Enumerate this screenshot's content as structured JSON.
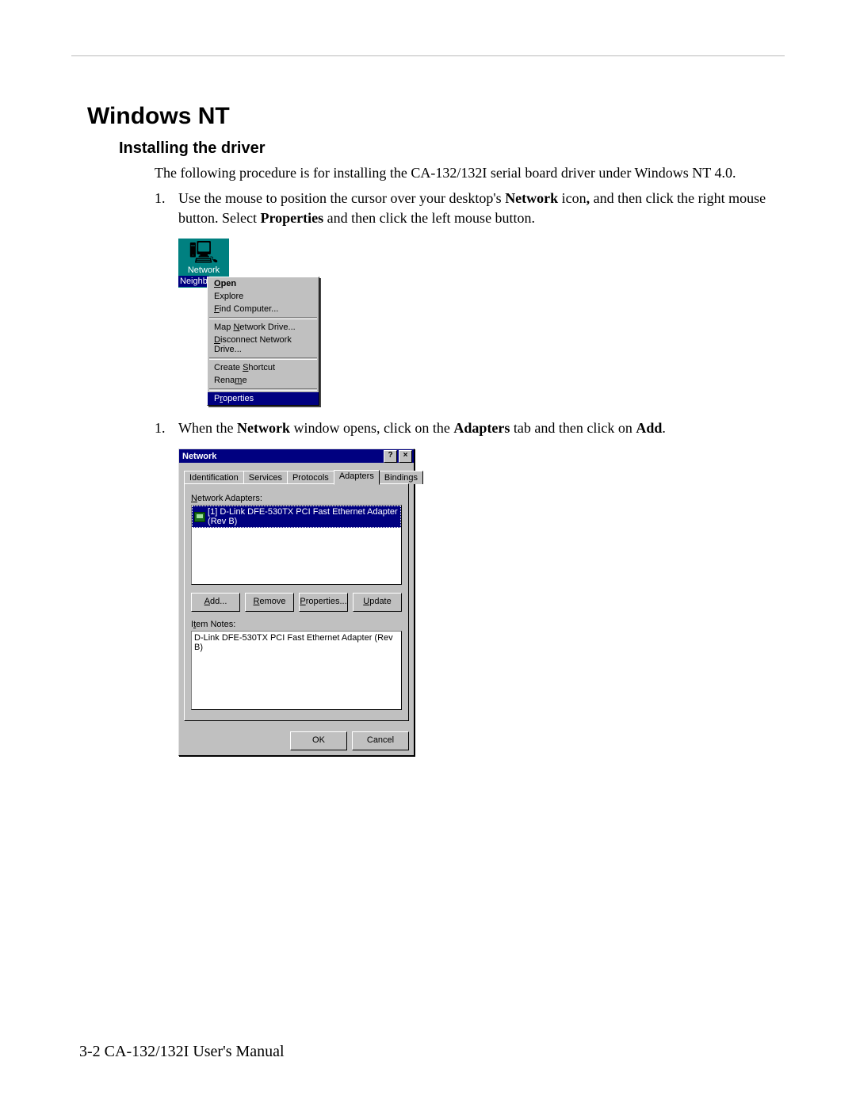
{
  "doc": {
    "heading": "Windows NT",
    "subheading": "Installing the driver",
    "intro": "The following procedure is for installing the CA-132/132I serial board driver under Windows NT 4.0.",
    "step1_a": "Use the mouse to position the cursor over your desktop's ",
    "step1_b_bold": "Network",
    "step1_c": " icon",
    "step1_d_bold": ",",
    "step1_e": " and then click the right mouse button. Select ",
    "step1_f_bold": "Properties",
    "step1_g": " and then click the left mouse button.",
    "step2_a": "When the ",
    "step2_b_bold": "Network",
    "step2_c": " window opens, click on the ",
    "step2_d_bold": "Adapters",
    "step2_e": " tab and then click on ",
    "step2_f_bold": "Add",
    "step2_g": ".",
    "footer": "3-2   CA-132/132I User's Manual"
  },
  "ctx": {
    "icon_glyph": "🖳",
    "icon_label": "Network",
    "icon_label2": "Neighb",
    "open": "Open",
    "explore": "Explore",
    "find": "Find Computer...",
    "map": "Map Network Drive...",
    "disconnect": "Disconnect Network Drive...",
    "shortcut": "Create Shortcut",
    "rename": "Rename",
    "properties": "Properties"
  },
  "dlg": {
    "title": "Network",
    "help_glyph": "?",
    "close_glyph": "×",
    "tabs": {
      "identification": "Identification",
      "services": "Services",
      "protocols": "Protocols",
      "adapters": "Adapters",
      "bindings": "Bindings"
    },
    "adapters_label": "Network Adapters:",
    "adapter_item": "[1] D-Link DFE-530TX PCI Fast Ethernet Adapter (Rev B)",
    "btn_add": "Add...",
    "btn_remove": "Remove",
    "btn_properties": "Properties...",
    "btn_update": "Update",
    "item_notes_label": "Item Notes:",
    "item_notes_text": "D-Link DFE-530TX PCI Fast Ethernet Adapter (Rev B)",
    "btn_ok": "OK",
    "btn_cancel": "Cancel"
  }
}
